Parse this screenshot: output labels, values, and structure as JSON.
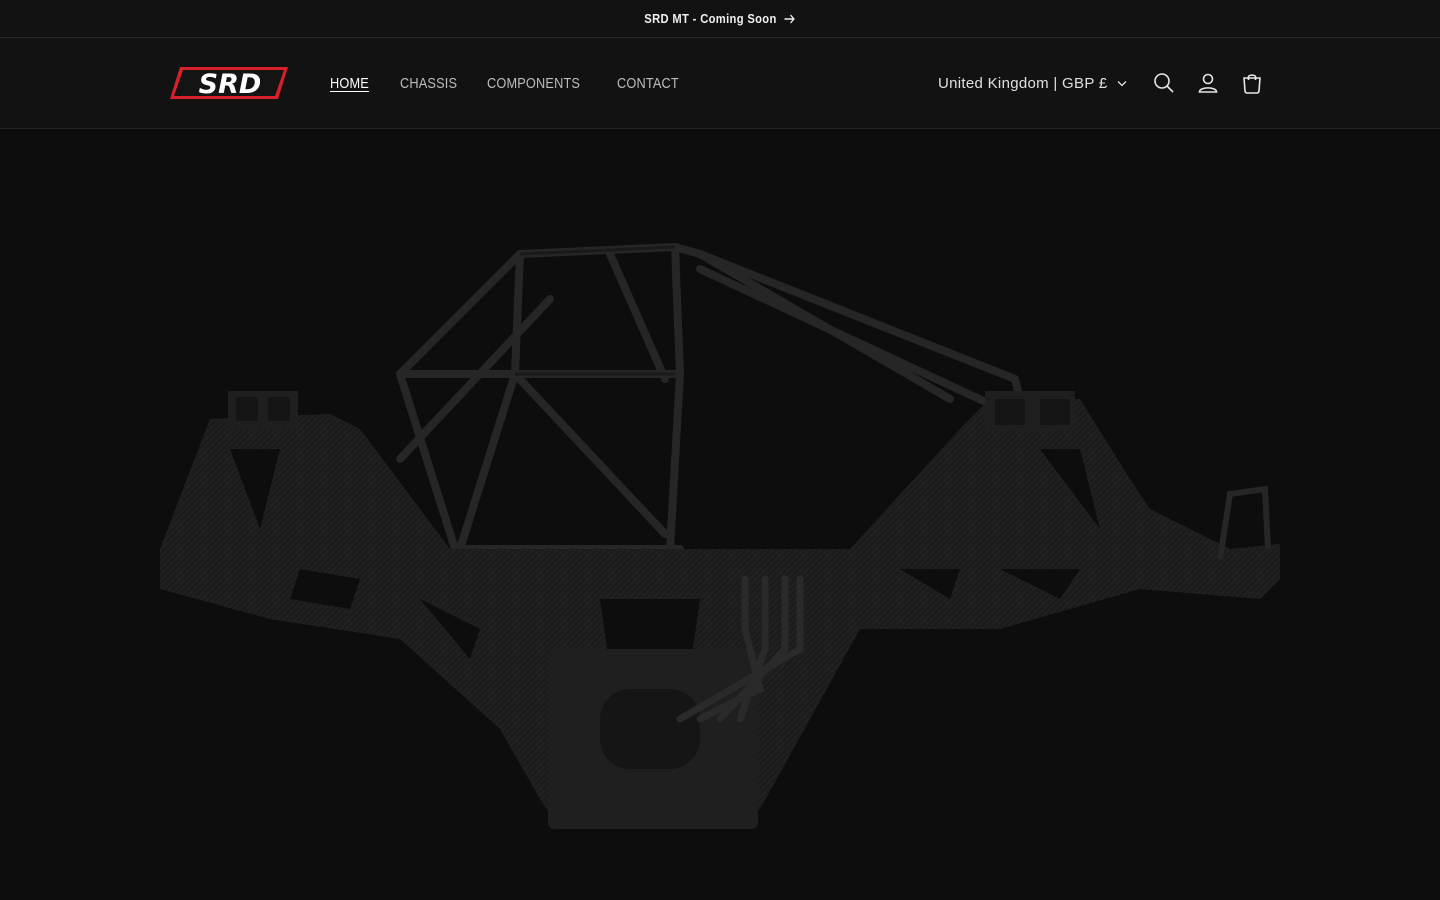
{
  "announcement": {
    "text": "SRD MT - Coming Soon",
    "arrow_icon": "arrow-right-icon"
  },
  "header": {
    "logo_text": "SRD",
    "nav": [
      {
        "label": "HOME",
        "active": true
      },
      {
        "label": "CHASSIS",
        "active": false
      },
      {
        "label": "COMPONENTS",
        "active": false
      },
      {
        "label": "CONTACT",
        "active": false
      }
    ],
    "country_selector": "United Kingdom | GBP £",
    "icons": [
      "search-icon",
      "account-icon",
      "cart-icon"
    ]
  },
  "colors": {
    "background": "#0d0d0e",
    "header_bg": "#121213",
    "logo_red": "#d6202a",
    "text": "#e6e6e6"
  },
  "hero": {
    "image": "rc-truck-chassis-render"
  }
}
